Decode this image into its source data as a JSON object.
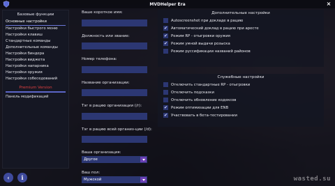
{
  "window": {
    "title": "MVDHelper Era",
    "close_label": "×"
  },
  "sidebar": {
    "section_title": "Базовые функции",
    "items": [
      {
        "label": "Основные настройки",
        "active": true
      },
      {
        "label": "Настройки быстрого меню"
      },
      {
        "label": "Настройки клавиш"
      },
      {
        "label": "Стандартные команды"
      },
      {
        "label": "Дополнительные команды"
      },
      {
        "label": "Настройки биндера"
      },
      {
        "label": "Настройки виджета"
      },
      {
        "label": "Настройки напарника"
      },
      {
        "label": "Настройки оружия"
      },
      {
        "label": "Настройки собеседований"
      }
    ],
    "premium_title": "Premium Version",
    "premium_items": [
      {
        "label": "Панель модификаций"
      }
    ],
    "back_icon_glyph": "‹",
    "info_icon_glyph": "i"
  },
  "form": {
    "short_name_label": "Ваше короткое имя:",
    "short_name_value": "",
    "position_label": "Должность или звание:",
    "position_value": "",
    "phone_label": "Номер телефона:",
    "phone_value": "",
    "org_name_label": "Название организации:",
    "org_name_value": "",
    "radio_tag_label": "Тэг в рацию организации (/r):",
    "radio_tag_value": "",
    "dept_tag_label": "Тэг в рацию всей организ-ции (/d):",
    "dept_tag_value": "",
    "org_select_label": "Ваша организация:",
    "org_select_value": "Другое",
    "gender_select_label": "Ваш пол:",
    "gender_select_value": "Мужской"
  },
  "extra_settings": {
    "title": "Дополнительные настройки",
    "options": [
      {
        "label": "Autoscreenshot при докладе в рацию",
        "checked": false
      },
      {
        "label": "Автоматический доклад в рацию при аресте",
        "checked": true
      },
      {
        "label": "Режим RP - отыгровки оружия",
        "checked": true
      },
      {
        "label": "Режим умной выдачи розыска",
        "checked": true
      },
      {
        "label": "Режим руссификации названий районов",
        "checked": false
      }
    ]
  },
  "service_settings": {
    "title": "Служебные настройки",
    "options": [
      {
        "label": "Отключить стандартные RP - отыгровки",
        "checked": false
      },
      {
        "label": "Отключить подсказки",
        "checked": false
      },
      {
        "label": "Отключить обновление кодексов",
        "checked": false
      },
      {
        "label": "Режим оптимизации для ENB",
        "checked": true
      },
      {
        "label": "Участвовать в бета-тестировании",
        "checked": true
      }
    ]
  },
  "icons": {
    "check": "✔"
  },
  "watermark": "wasted.su"
}
